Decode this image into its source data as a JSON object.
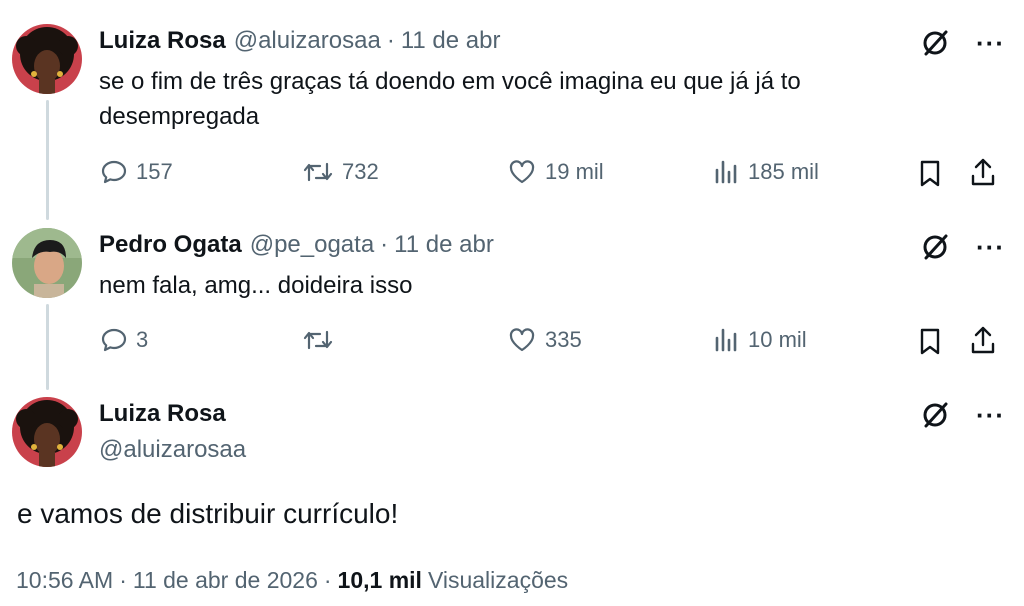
{
  "tweets": [
    {
      "name": "Luiza Rosa",
      "handle": "@aluizarosaa",
      "sep": "·",
      "date": "11 de abr",
      "text_line1": "se o fim de três graças tá doendo em você imagina eu que já já to",
      "text_line2": "desempregada",
      "replies": "157",
      "reposts": "732",
      "likes": "19 mil",
      "views": "185 mil"
    },
    {
      "name": "Pedro Ogata",
      "handle": "@pe_ogata",
      "sep": "·",
      "date": "11 de abr",
      "text_line1": "nem fala, amg... doideira isso",
      "replies": "3",
      "reposts": "",
      "likes": "335",
      "views": "10 mil"
    }
  ],
  "main_tweet": {
    "name": "Luiza Rosa",
    "handle": "@aluizarosaa",
    "text": "e vamos de distribuir currículo!",
    "time": "10:56 AM",
    "sep1": "·",
    "date": "11 de abr de 2026",
    "sep2": "·",
    "views_count": "10,1 mil",
    "views_label": "Visualizações"
  },
  "icons": {
    "grok": "grok-icon",
    "more": "more-icon",
    "reply": "reply-icon",
    "repost": "repost-icon",
    "like": "heart-icon",
    "views": "views-icon",
    "bookmark": "bookmark-icon",
    "share": "share-icon"
  },
  "more_glyph": "···"
}
